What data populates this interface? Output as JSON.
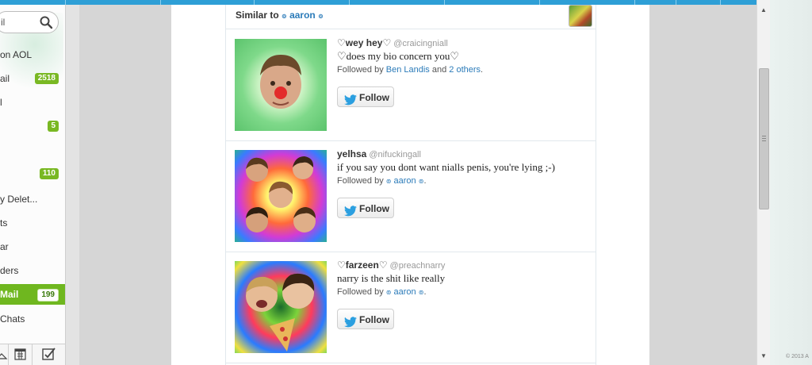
{
  "colors": {
    "aol_blue": "#2e9fd6",
    "sidebar_active": "#6fb71f",
    "badge_green": "#79b823",
    "link_blue": "#2b7bb9"
  },
  "sidebar": {
    "search": {
      "value": "il",
      "icon": "search-icon"
    },
    "items": [
      {
        "label": "on AOL",
        "badge": ""
      },
      {
        "label": "ail",
        "badge": "2518"
      },
      {
        "label": "l",
        "badge": ""
      },
      {
        "label": "",
        "badge": "5"
      },
      {
        "label": "",
        "badge": ""
      },
      {
        "label": "",
        "badge": "110"
      },
      {
        "label": "y Delet...",
        "badge": ""
      },
      {
        "label": "ts",
        "badge": ""
      },
      {
        "label": "ar",
        "badge": ""
      },
      {
        "label": "ders",
        "badge": ""
      },
      {
        "label": "Mail",
        "badge": "199"
      },
      {
        "label": "Chats",
        "badge": ""
      }
    ],
    "bottom_icons": [
      "contacts-icon",
      "calendar-icon",
      "tasks-icon"
    ]
  },
  "similar": {
    "title": "Similar to",
    "user": "aaron",
    "users": [
      {
        "name": "♡wey hey♡",
        "handle": "@craicingniall",
        "bio": "♡does my bio concern you♡",
        "followed_prefix": "Followed by",
        "followed_by": "Ben Landis",
        "followed_and": "and",
        "followed_others": "2 others",
        "followed_suffix": ".",
        "button": "Follow"
      },
      {
        "name": "yelhsa",
        "handle": "@nifuckingall",
        "bio": "if you say you dont want nialls penis, you're lying ;-)",
        "followed_prefix": "Followed by",
        "followed_by": "aaron",
        "followed_suffix": ".",
        "button": "Follow"
      },
      {
        "name": "♡farzeen♡",
        "handle": "@preachnarry",
        "bio": "narry is the shit like really",
        "followed_prefix": "Followed by",
        "followed_by": "aaron",
        "followed_suffix": ".",
        "button": "Follow"
      }
    ]
  },
  "footer": {
    "copyright": "© 2013 A"
  }
}
